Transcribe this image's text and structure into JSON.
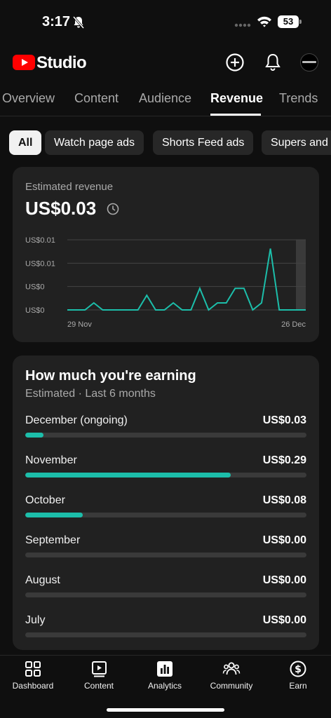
{
  "status_bar": {
    "time": "3:17",
    "battery": "53"
  },
  "header": {
    "brand": "Studio"
  },
  "tabs": [
    {
      "label": "Overview",
      "active": false
    },
    {
      "label": "Content",
      "active": false
    },
    {
      "label": "Audience",
      "active": false
    },
    {
      "label": "Revenue",
      "active": true
    },
    {
      "label": "Trends",
      "active": false
    }
  ],
  "chips": [
    {
      "label": "All",
      "active": true
    },
    {
      "label": "Watch page ads",
      "active": false
    },
    {
      "label": "Shorts Feed ads",
      "active": false
    },
    {
      "label": "Supers and",
      "active": false
    }
  ],
  "revenue_card": {
    "label": "Estimated revenue",
    "amount": "US$0.03"
  },
  "chart_data": {
    "type": "line",
    "y_tick_labels": [
      "US$0.01",
      "US$0.01",
      "US$0",
      "US$0"
    ],
    "x_tick_labels": [
      "29 Nov",
      "26 Dec"
    ],
    "x": [
      "29 Nov",
      "30 Nov",
      "1 Dec",
      "2 Dec",
      "3 Dec",
      "4 Dec",
      "5 Dec",
      "6 Dec",
      "7 Dec",
      "8 Dec",
      "9 Dec",
      "10 Dec",
      "11 Dec",
      "12 Dec",
      "13 Dec",
      "14 Dec",
      "15 Dec",
      "16 Dec",
      "17 Dec",
      "18 Dec",
      "19 Dec",
      "20 Dec",
      "21 Dec",
      "22 Dec",
      "23 Dec",
      "24 Dec",
      "25 Dec",
      "26 Dec"
    ],
    "values": [
      0,
      0,
      0,
      0.0012,
      0,
      0,
      0,
      0,
      0,
      0.0025,
      0,
      0,
      0.0012,
      0,
      0,
      0.0037,
      0,
      0.0012,
      0.0012,
      0.0037,
      0.0037,
      0,
      0.0012,
      0.0105,
      0,
      0,
      0,
      0
    ],
    "ylim": [
      0,
      0.012
    ],
    "line_color": "#1cbeaa",
    "grid": true
  },
  "earnings": {
    "title": "How much you're earning",
    "subtitle": "Estimated · Last 6 months",
    "accent_color": "#1cbeaa",
    "rows": [
      {
        "month": "December (ongoing)",
        "value": "US$0.03",
        "fraction": 0.065
      },
      {
        "month": "November",
        "value": "US$0.29",
        "fraction": 0.73
      },
      {
        "month": "October",
        "value": "US$0.08",
        "fraction": 0.205
      },
      {
        "month": "September",
        "value": "US$0.00",
        "fraction": 0
      },
      {
        "month": "August",
        "value": "US$0.00",
        "fraction": 0
      },
      {
        "month": "July",
        "value": "US$0.00",
        "fraction": 0
      }
    ]
  },
  "bottom_nav": [
    {
      "label": "Dashboard",
      "icon": "dashboard-icon"
    },
    {
      "label": "Content",
      "icon": "content-icon"
    },
    {
      "label": "Analytics",
      "icon": "analytics-icon"
    },
    {
      "label": "Community",
      "icon": "community-icon"
    },
    {
      "label": "Earn",
      "icon": "earn-icon"
    }
  ]
}
